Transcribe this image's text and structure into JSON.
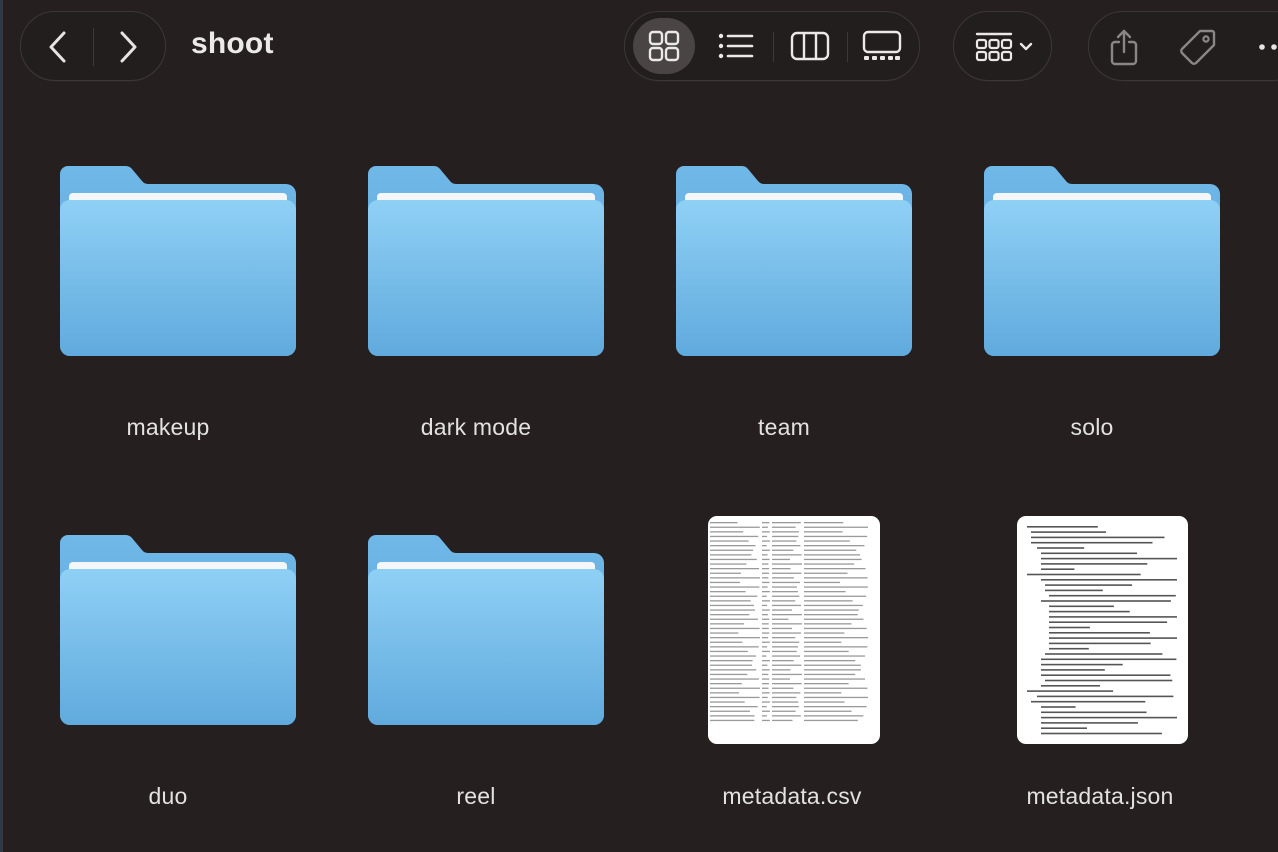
{
  "window": {
    "title": "shoot"
  },
  "toolbar": {
    "back_icon": "chevron-left-icon",
    "forward_icon": "chevron-right-icon",
    "view_modes": [
      {
        "name": "icon-view",
        "icon": "grid-icon",
        "active": true
      },
      {
        "name": "list-view",
        "icon": "list-icon",
        "active": false
      },
      {
        "name": "column-view",
        "icon": "columns-icon",
        "active": false
      },
      {
        "name": "gallery-view",
        "icon": "gallery-icon",
        "active": false
      }
    ],
    "group_icon": "group-grid-icon",
    "actions": [
      "share-icon",
      "tag-icon",
      "more-icon"
    ]
  },
  "items": [
    {
      "label": "makeup",
      "kind": "folder"
    },
    {
      "label": "dark mode",
      "kind": "folder"
    },
    {
      "label": "team",
      "kind": "folder"
    },
    {
      "label": "solo",
      "kind": "folder"
    },
    {
      "label": "duo",
      "kind": "folder"
    },
    {
      "label": "reel",
      "kind": "folder"
    },
    {
      "label": "metadata.csv",
      "kind": "csv-file"
    },
    {
      "label": "metadata.json",
      "kind": "json-file"
    }
  ],
  "colors": {
    "background": "#251f1f",
    "folder_top": "#8ccdf2",
    "folder_bottom": "#5fa9dc",
    "folder_back": "#6cb5e6",
    "active_view_bg": "#4a4444"
  }
}
